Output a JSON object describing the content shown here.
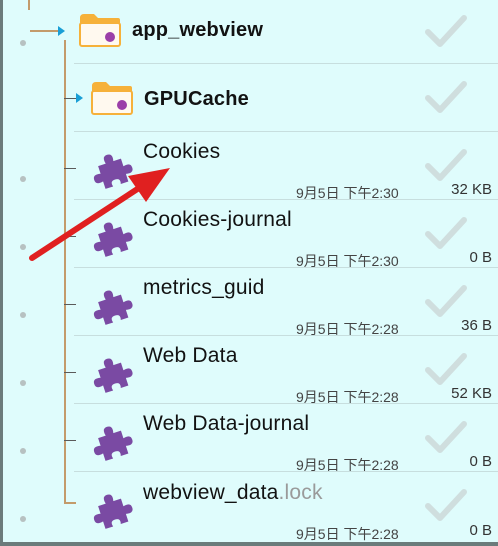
{
  "files": [
    {
      "name": "app_webview",
      "ext": "",
      "date": "",
      "size": ""
    },
    {
      "name": "GPUCache",
      "ext": "",
      "date": "",
      "size": ""
    },
    {
      "name": "Cookies",
      "ext": "",
      "date": "9月5日 下午2:30",
      "size": "32 KB"
    },
    {
      "name": "Cookies-journal",
      "ext": "",
      "date": "9月5日 下午2:30",
      "size": "0 B"
    },
    {
      "name": "metrics_guid",
      "ext": "",
      "date": "9月5日 下午2:28",
      "size": "36 B"
    },
    {
      "name": "Web Data",
      "ext": "",
      "date": "9月5日 下午2:28",
      "size": "52 KB"
    },
    {
      "name": "Web Data-journal",
      "ext": "",
      "date": "9月5日 下午2:28",
      "size": "0 B"
    },
    {
      "name": "webview_data",
      "ext": ".lock",
      "date": "9月5日 下午2:28",
      "size": "0 B"
    }
  ],
  "colors": {
    "background": "#dffcfc",
    "folder": "#f6b13a",
    "puzzle": "#7a4aa3",
    "tree_arrow": "#1a9fd6",
    "annotation_arrow": "#e02020",
    "checkmark": "#cfdede"
  },
  "icons": {
    "folder": "folder-icon",
    "file": "puzzle-icon",
    "check": "checkmark-icon",
    "expander": "expand-arrow-icon"
  }
}
